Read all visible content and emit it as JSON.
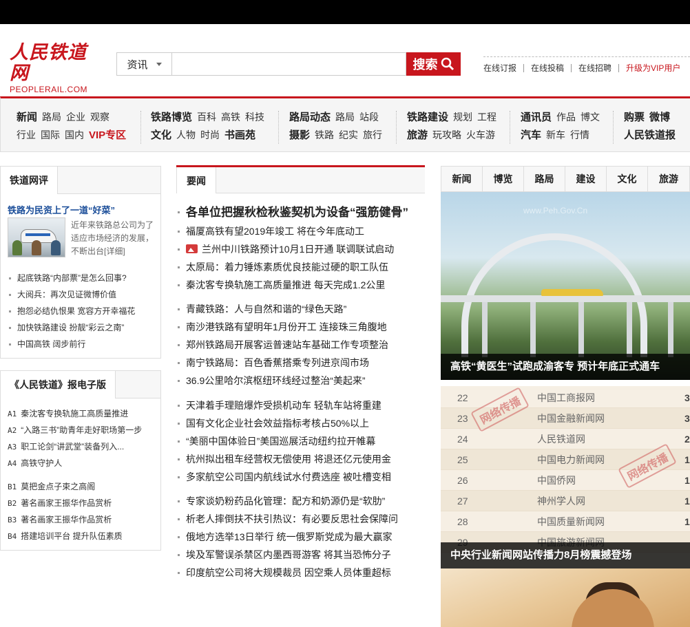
{
  "logo": {
    "cn": "人民铁道网",
    "en": "PEOPLERAIL.COM"
  },
  "search": {
    "category": "资讯",
    "value": "",
    "placeholder": "",
    "button": "搜索"
  },
  "toplinks": [
    "在线订报",
    "在线投稿",
    "在线招聘",
    "升级为VIP用户"
  ],
  "nav": [
    {
      "row1": [
        {
          "t": "新闻",
          "s": "b"
        },
        {
          "t": "路局"
        },
        {
          "t": "企业"
        },
        {
          "t": "观察"
        }
      ],
      "row2": [
        {
          "t": "行业"
        },
        {
          "t": "国际"
        },
        {
          "t": "国内"
        },
        {
          "t": "VIP专区",
          "s": "red"
        }
      ]
    },
    {
      "row1": [
        {
          "t": "铁路博览",
          "s": "b"
        },
        {
          "t": "百科"
        },
        {
          "t": "高铁"
        },
        {
          "t": "科技"
        }
      ],
      "row2": [
        {
          "t": "文化",
          "s": "b"
        },
        {
          "t": "人物"
        },
        {
          "t": "时尚"
        },
        {
          "t": "书画苑",
          "s": "b"
        }
      ]
    },
    {
      "row1": [
        {
          "t": "路局动态",
          "s": "b"
        },
        {
          "t": "路局"
        },
        {
          "t": "站段"
        }
      ],
      "row2": [
        {
          "t": "摄影",
          "s": "b"
        },
        {
          "t": "铁路"
        },
        {
          "t": "纪实"
        },
        {
          "t": "旅行"
        }
      ]
    },
    {
      "row1": [
        {
          "t": "铁路建设",
          "s": "b"
        },
        {
          "t": "规划"
        },
        {
          "t": "工程"
        }
      ],
      "row2": [
        {
          "t": "旅游",
          "s": "b"
        },
        {
          "t": "玩攻略"
        },
        {
          "t": "火车游"
        }
      ]
    },
    {
      "row1": [
        {
          "t": "通讯员",
          "s": "b"
        },
        {
          "t": "作品"
        },
        {
          "t": "博文"
        }
      ],
      "row2": [
        {
          "t": "汽车",
          "s": "b"
        },
        {
          "t": "新车"
        },
        {
          "t": "行情"
        }
      ]
    },
    {
      "row1": [
        {
          "t": "购票",
          "s": "b"
        },
        {
          "t": "微博",
          "s": "b"
        }
      ],
      "row2": [
        {
          "t": "人民铁道报",
          "s": "b"
        }
      ]
    }
  ],
  "left": {
    "review_tab": "铁道网评",
    "review_title": "铁路为民资上了一道“好菜”",
    "review_summary": "近年来铁路总公司为了适应市场经济的发展，不断出台[详细]",
    "review_list": [
      "起底铁路“内部票”是怎么回事?",
      "大阅兵：再次见证微博价值",
      "抱怨必结仇恨果 宽容方开幸福花",
      "加快铁路建设 扮靓“彩云之南”",
      "中国高铁 阔步前行"
    ],
    "paper_tab": "《人民铁道》报电子版",
    "paper_a": [
      {
        "pg": "A1",
        "t": "秦沈客专换轨施工高质量推进"
      },
      {
        "pg": "A2",
        "t": "“入路三书”助青年走好职场第一步"
      },
      {
        "pg": "A3",
        "t": "职工论剑“讲武堂”装备列入..."
      },
      {
        "pg": "A4",
        "t": "高铁守护人"
      }
    ],
    "paper_b": [
      {
        "pg": "B1",
        "t": "莫把金点子束之高阁"
      },
      {
        "pg": "B2",
        "t": "著名画家王振华作品赏析"
      },
      {
        "pg": "B3",
        "t": "著名画家王振华作品赏析"
      },
      {
        "pg": "B4",
        "t": "搭建培训平台 提升队伍素质"
      }
    ]
  },
  "middle": {
    "tab": "要闻",
    "headline": "各单位把握秋检秋鉴契机为设备“强筋健骨”",
    "group1": [
      "福厦高铁有望2019年竣工 将在今年底动工",
      "兰州中川铁路预计10月1日开通 联调联试启动",
      "太原局：着力锤炼素质优良技能过硬的职工队伍",
      "秦沈客专换轨施工高质量推进 每天完成1.2公里"
    ],
    "group2": [
      "青藏铁路：人与自然和谐的“绿色天路”",
      "南沙港铁路有望明年1月份开工 连接珠三角腹地",
      "郑州铁路局开展客运普速站车基础工作专项整治",
      "南宁铁路局：百色香蕉搭乘专列进京闯市场",
      "36.9公里哈尔滨枢纽环线经过整治“美起来”"
    ],
    "group3": [
      "天津着手理赔爆炸受损机动车 轻轨车站将重建",
      "国有文化企业社会效益指标考核占50%以上",
      "“美丽中国体验日”美国巡展活动纽约拉开帷幕",
      "杭州拟出租车经营权无偿使用 将退还亿元使用金",
      "多家航空公司国内航线试水付费选座 被吐槽变相"
    ],
    "group4": [
      "专家谈奶粉药品化管理：配方和奶源仍是“软肋”",
      "析老人摔倒扶不扶引热议：有必要反思社会保障问",
      "俄地方选举13日举行 统一俄罗斯党成为最大赢家",
      "埃及军警误杀禁区内墨西哥游客 将其当恐怖分子",
      "印度航空公司将大规模裁员 因空乘人员体重超标"
    ]
  },
  "right": {
    "tabs": [
      "新闻",
      "博览",
      "路局",
      "建设",
      "文化",
      "旅游"
    ],
    "photo1_caption": "高铁“黄医生”试跑成渝客专 预计年底正式通车",
    "photo1_watermark": "www.Peh.Gov.Cn",
    "rank_rows": [
      {
        "n": "22",
        "name": "中国工商报网",
        "v": "3"
      },
      {
        "n": "23",
        "name": "中国金融新闻网",
        "v": "3"
      },
      {
        "n": "24",
        "name": "人民铁道网",
        "v": "2"
      },
      {
        "n": "25",
        "name": "中国电力新闻网",
        "v": "1"
      },
      {
        "n": "26",
        "name": "中国侨网",
        "v": "1"
      },
      {
        "n": "27",
        "name": "神州学人网",
        "v": "1"
      },
      {
        "n": "28",
        "name": "中国质量新闻网",
        "v": "1"
      },
      {
        "n": "29",
        "name": "中国旅游新闻网",
        "v": ""
      }
    ],
    "stamp": "网络传播",
    "photo2_caption": "中央行业新闻网站传播力8月榜震撼登场"
  },
  "colors": {
    "brand": "#c8161d",
    "link_blue": "#1a4d99"
  }
}
